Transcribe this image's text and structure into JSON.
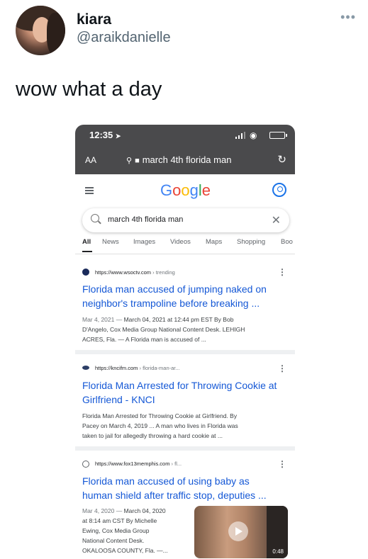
{
  "tweet": {
    "display_name": "kiara",
    "handle": "@araikdanielle",
    "more_icon": "more-horizontal-icon",
    "text": "wow what a day"
  },
  "phone": {
    "status_time": "12:35",
    "aa_label": "AA",
    "url": "march 4th florida man",
    "google_logo": [
      "G",
      "o",
      "o",
      "g",
      "l",
      "e"
    ],
    "google_colors": [
      "#4285f4",
      "#ea4335",
      "#fbbc05",
      "#4285f4",
      "#34a853",
      "#ea4335"
    ],
    "search_query": "march 4th florida man",
    "tabs": [
      "All",
      "News",
      "Images",
      "Videos",
      "Maps",
      "Shopping",
      "Boo"
    ],
    "results": [
      {
        "cite": "https://www.wsoctv.com",
        "cite_sub": " › trending",
        "title_line1": "Florida man accused of jumping naked on",
        "title_line2": "neighbor's trampoline before breaking ...",
        "snippet_date": "Mar 4, 2021 —",
        "snippet_line1": " March 04, 2021 at 12:44 pm EST By Bob",
        "snippet_line2": "D'Angelo, Cox Media Group National Content Desk. LEHIGH",
        "snippet_line3": "ACRES, Fla. — A Florida man is accused of ..."
      },
      {
        "cite": "https://kncifm.com",
        "cite_sub": " › florida-man-ar...",
        "title_line1": "Florida Man Arrested for Throwing Cookie at",
        "title_line2": "Girlfriend - KNCI",
        "snippet_line1": "Florida Man Arrested for Throwing Cookie at Girlfriend. By",
        "snippet_line2": "Pacey on March 4, 2019 ... A man who lives in Florida was",
        "snippet_line3": "taken to jail for allegedly throwing a hard cookie at ..."
      },
      {
        "cite": "https://www.fox13memphis.com",
        "cite_sub": " › fl...",
        "title_line1": "Florida man accused of using baby as",
        "title_line2": "human shield after traffic stop, deputies ...",
        "snippet_date": "Mar 4, 2020 —",
        "snippet_line1": " March 04, 2020",
        "snippet_line2": "at 8:14 am CST By Michelle",
        "snippet_line3": "Ewing, Cox Media Group",
        "snippet_line4": "National Content Desk.",
        "snippet_line5": "OKALOOSA COUNTY, Fla. —...",
        "video_duration": "0:48"
      }
    ]
  }
}
